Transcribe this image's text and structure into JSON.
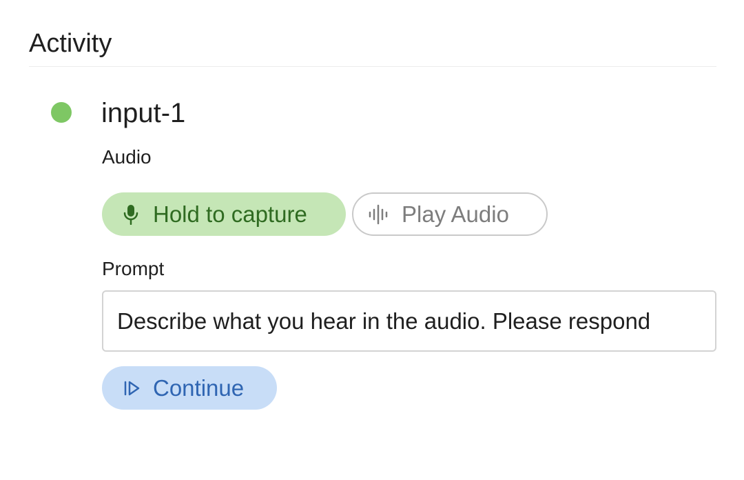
{
  "section": {
    "title": "Activity"
  },
  "node": {
    "name": "input-1",
    "status_color": "#7ec764",
    "audio": {
      "label": "Audio",
      "capture_button": {
        "label": "Hold to capture",
        "icon": "microphone-icon"
      },
      "play_button": {
        "label": "Play Audio",
        "icon": "waveform-icon"
      }
    },
    "prompt": {
      "label": "Prompt",
      "value": "Describe what you hear in the audio. Please respond"
    },
    "continue_button": {
      "label": "Continue",
      "icon": "skip-next-icon"
    }
  },
  "colors": {
    "capture_bg": "#c5e6b6",
    "capture_text": "#2f6b21",
    "continue_bg": "#c8ddf7",
    "continue_text": "#2f65b2",
    "play_border": "#c9c9c9",
    "play_text": "#7d7d7d"
  }
}
